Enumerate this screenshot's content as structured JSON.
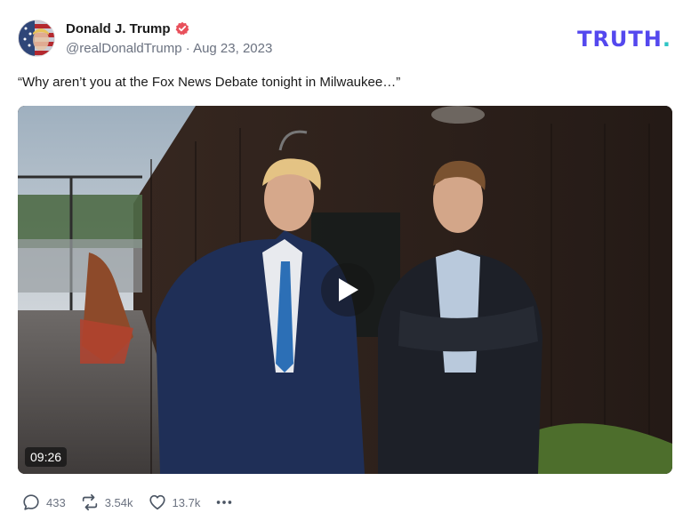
{
  "post": {
    "author": {
      "display_name": "Donald J. Trump",
      "handle": "@realDonaldTrump",
      "verified_icon": "verified-badge-icon",
      "avatar_icon": "avatar-flag-image"
    },
    "separator": " · ",
    "date": "Aug 23, 2023",
    "text": "“Why aren’t you at the Fox News Debate tonight in Milwaukee…”",
    "media": {
      "type": "video",
      "duration": "09:26",
      "play_icon": "play-icon"
    },
    "actions": {
      "replies": {
        "icon": "reply-icon",
        "count": "433"
      },
      "retruths": {
        "icon": "retruth-icon",
        "count": "3.54k"
      },
      "likes": {
        "icon": "heart-icon",
        "count": "13.7k"
      },
      "more": {
        "icon": "more-icon"
      }
    }
  },
  "brand": {
    "logo_text": "TRUTH",
    "logo_dot": ".",
    "logo_color": "#5448ee",
    "logo_dot_color": "#2fc5c5"
  },
  "colors": {
    "verified": "#e8505b",
    "muted_text": "#6b7280"
  }
}
